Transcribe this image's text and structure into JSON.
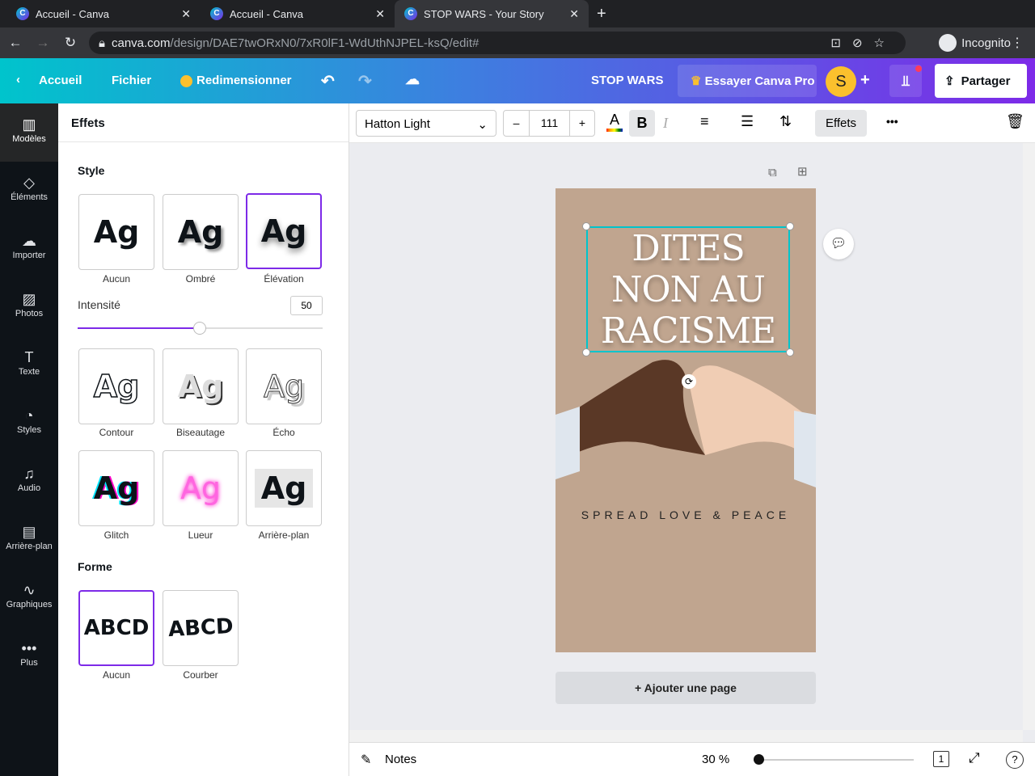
{
  "browser": {
    "tabs": [
      {
        "title": "Accueil - Canva"
      },
      {
        "title": "Accueil - Canva"
      },
      {
        "title": "STOP WARS - Your Story"
      }
    ],
    "url_host": "canva.com",
    "url_path": "/design/DAE7twORxN0/7xR0lF1-WdUthNJPEL-ksQ/edit#",
    "profile": "Incognito"
  },
  "topbar": {
    "home": "Accueil",
    "file": "Fichier",
    "resize": "Redimensionner",
    "title": "STOP WARS",
    "pro": "Essayer Canva Pro",
    "avatar": "S",
    "share": "Partager"
  },
  "sidebar": [
    {
      "label": "Modèles",
      "icon": "▥"
    },
    {
      "label": "Éléments",
      "icon": "◇"
    },
    {
      "label": "Importer",
      "icon": "☁"
    },
    {
      "label": "Photos",
      "icon": "▨"
    },
    {
      "label": "Texte",
      "icon": "T"
    },
    {
      "label": "Styles",
      "icon": "◔"
    },
    {
      "label": "Audio",
      "icon": "♫"
    },
    {
      "label": "Arrière-plan",
      "icon": "▤"
    },
    {
      "label": "Graphiques",
      "icon": "∿"
    },
    {
      "label": "Plus",
      "icon": "•••"
    }
  ],
  "panel": {
    "title": "Effets",
    "style_heading": "Style",
    "styles": [
      {
        "label": "Aucun"
      },
      {
        "label": "Ombré"
      },
      {
        "label": "Élévation"
      },
      {
        "label": "Contour"
      },
      {
        "label": "Biseautage"
      },
      {
        "label": "Écho"
      },
      {
        "label": "Glitch"
      },
      {
        "label": "Lueur"
      },
      {
        "label": "Arrière-plan"
      }
    ],
    "sample": "Ag",
    "intensity_label": "Intensité",
    "intensity": "50",
    "shape_heading": "Forme",
    "shapes": [
      {
        "label": "Aucun",
        "sample": "ABCD"
      },
      {
        "label": "Courber",
        "sample": "ABCD"
      }
    ]
  },
  "toolbar": {
    "font": "Hatton Light",
    "minus": "–",
    "size": "111",
    "plus": "+",
    "bold": "B",
    "italic": "I",
    "effects": "Effets",
    "more": "•••"
  },
  "design": {
    "headline": "DITES NON AU RACISME",
    "tagline": "SPREAD LOVE & PEACE",
    "add_page": "+ Ajouter une page"
  },
  "bottom": {
    "notes": "Notes",
    "zoom": "30 %",
    "pages": "1",
    "help": "?"
  }
}
